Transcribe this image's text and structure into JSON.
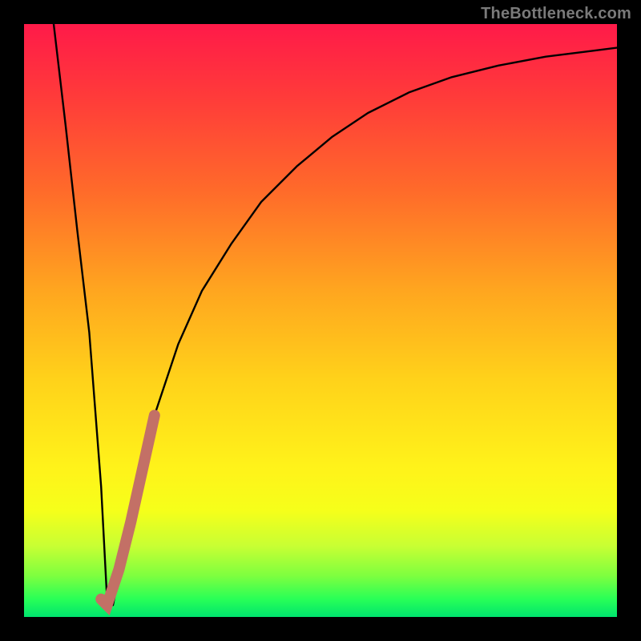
{
  "watermark": "TheBottleneck.com",
  "colors": {
    "curve": "#000000",
    "highlight": "#c37066",
    "frame": "#000000"
  },
  "chart_data": {
    "type": "line",
    "title": "",
    "xlabel": "",
    "ylabel": "",
    "xlim": [
      0,
      100
    ],
    "ylim": [
      0,
      100
    ],
    "grid": false,
    "legend": false,
    "background_gradient": "red-to-green vertical",
    "series": [
      {
        "name": "bottleneck-curve",
        "color": "#000000",
        "x": [
          5,
          7,
          9,
          11,
          13,
          14,
          15,
          17,
          19,
          22,
          26,
          30,
          35,
          40,
          46,
          52,
          58,
          65,
          72,
          80,
          88,
          96,
          100
        ],
        "y": [
          100,
          83,
          65,
          48,
          22,
          3,
          2,
          12,
          22,
          34,
          46,
          55,
          63,
          70,
          76,
          81,
          85,
          88.5,
          91,
          93,
          94.5,
          95.5,
          96
        ]
      },
      {
        "name": "highlight-segment",
        "color": "#c37066",
        "x": [
          13,
          14,
          16,
          18,
          20,
          22
        ],
        "y": [
          3,
          2,
          8,
          16,
          25,
          34
        ]
      }
    ],
    "notes": "Values are read off the plot area in percent of axis range; no tick labels are shown in the source image."
  }
}
